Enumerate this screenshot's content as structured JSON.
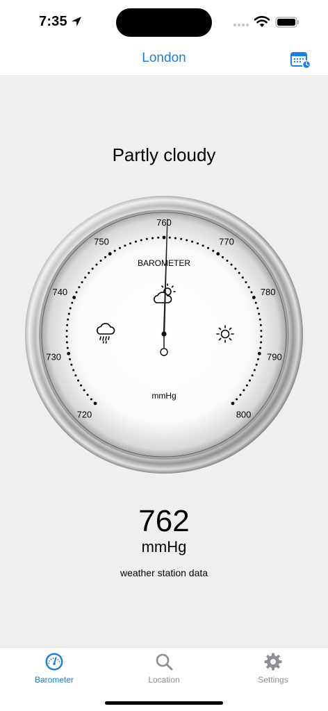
{
  "status_bar": {
    "time": "7:35"
  },
  "nav": {
    "title": "London",
    "calendar_icon": "calendar-clock-icon"
  },
  "main": {
    "condition": "Partly cloudy",
    "reading_value": "762",
    "reading_unit": "mmHg",
    "source": "weather station data"
  },
  "gauge": {
    "label": "BAROMETER",
    "unit": "mmHg",
    "min": 720,
    "max": 800,
    "tick_labels": [
      "720",
      "730",
      "740",
      "750",
      "760",
      "770",
      "780",
      "790",
      "800"
    ],
    "needle_value": 760.5,
    "icons": [
      "rain-cloud-icon",
      "partly-cloudy-icon",
      "sun-icon"
    ]
  },
  "tabs": [
    {
      "label": "Barometer",
      "icon": "gauge-icon",
      "active": true
    },
    {
      "label": "Location",
      "icon": "search-icon",
      "active": false
    },
    {
      "label": "Settings",
      "icon": "gear-icon",
      "active": false
    }
  ],
  "colors": {
    "accent": "#1a7fe0",
    "inactive": "#8e8e93"
  }
}
